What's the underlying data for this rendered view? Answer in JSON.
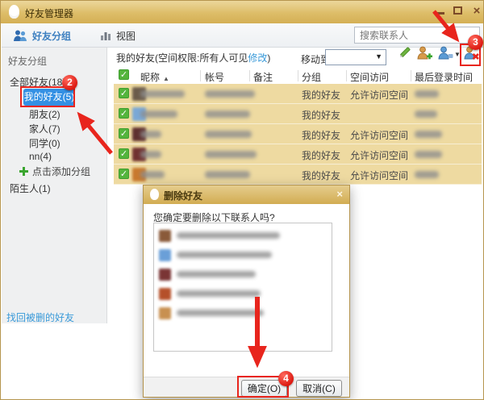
{
  "window": {
    "title": "好友管理器"
  },
  "toolbar": {
    "groups": "好友分组",
    "view": "视图",
    "search_placeholder": "搜索联系人"
  },
  "sidebar": {
    "header": "好友分组",
    "all_friends": "全部好友(18)",
    "my_friends": "我的好友(5)",
    "friends": "朋友(2)",
    "family": "家人(7)",
    "classmates": "同学(0)",
    "nn": "nn(4)",
    "add_group": "点击添加分组",
    "strangers": "陌生人(1)",
    "recover_link": "找回被删的好友"
  },
  "main": {
    "header_prefix": "我的好友(空间权限:所有人可见",
    "modify_link": "修改",
    "header_suffix": ")",
    "move_to": "移动到",
    "table": {
      "columns": [
        "昵称",
        "帐号",
        "备注",
        "分组",
        "空间访问",
        "最后登录时间"
      ],
      "rows": [
        {
          "group": "我的好友",
          "access": "允许访问空间"
        },
        {
          "group": "我的好友",
          "access": ""
        },
        {
          "group": "我的好友",
          "access": "允许访问空间"
        },
        {
          "group": "我的好友",
          "access": "允许访问空间"
        },
        {
          "group": "我的好友",
          "access": "允许访问空间"
        }
      ]
    }
  },
  "dialog": {
    "title": "删除好友",
    "message": "您确定要删除以下联系人吗?",
    "ok": "确定(O)",
    "cancel": "取消(C)"
  },
  "annotations": {
    "step2": "2",
    "step3": "3",
    "step4": "4"
  },
  "colors": {
    "title_gold": "#d6b25c",
    "accent_blue": "#3390e4",
    "link_blue": "#3a9ad9",
    "row_tan": "#eedaa1",
    "annotation_red": "#e8251d",
    "checkbox_green": "#53b43c"
  }
}
